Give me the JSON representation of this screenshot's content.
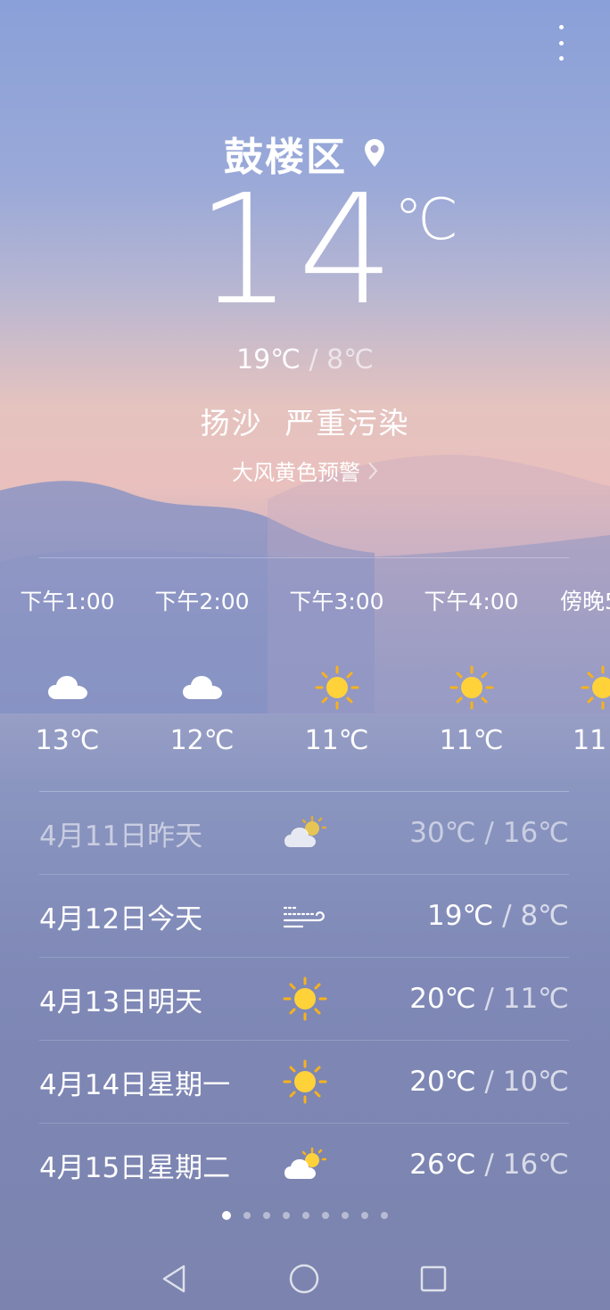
{
  "location": {
    "city": "鼓楼区"
  },
  "current": {
    "temperature": "14",
    "unit": "℃",
    "high": "19℃",
    "separator": "/",
    "low": "8℃",
    "conditions": "扬沙  严重污染",
    "alert": "大风黄色预警"
  },
  "hourly": [
    {
      "time": "下午1:00",
      "icon": "cloud-icon",
      "temp": "13℃"
    },
    {
      "time": "下午2:00",
      "icon": "cloud-icon",
      "temp": "12℃"
    },
    {
      "time": "下午3:00",
      "icon": "sun-icon",
      "temp": "11℃"
    },
    {
      "time": "下午4:00",
      "icon": "sun-icon",
      "temp": "11℃"
    },
    {
      "time": "傍晚5",
      "icon": "sun-icon",
      "temp": "11"
    }
  ],
  "daily": [
    {
      "date": "4月11日昨天",
      "icon": "partly-cloudy-icon",
      "high": "30℃",
      "sep": "/",
      "low": "16℃",
      "past": true
    },
    {
      "date": "4月12日今天",
      "icon": "wind-icon",
      "high": "19℃",
      "sep": "/",
      "low": "8℃",
      "past": false
    },
    {
      "date": "4月13日明天",
      "icon": "sun-icon",
      "high": "20℃",
      "sep": "/",
      "low": "11℃",
      "past": false
    },
    {
      "date": "4月14日星期一",
      "icon": "sun-icon",
      "high": "20℃",
      "sep": "/",
      "low": "10℃",
      "past": false
    },
    {
      "date": "4月15日星期二",
      "icon": "partly-cloudy-icon",
      "high": "26℃",
      "sep": "/",
      "low": "16℃",
      "past": false
    }
  ],
  "pager": {
    "count": 9,
    "active": 0
  },
  "colors": {
    "sun": "#ffd23a",
    "sun_ray": "#f7b21c",
    "cloud": "#ffffff"
  }
}
